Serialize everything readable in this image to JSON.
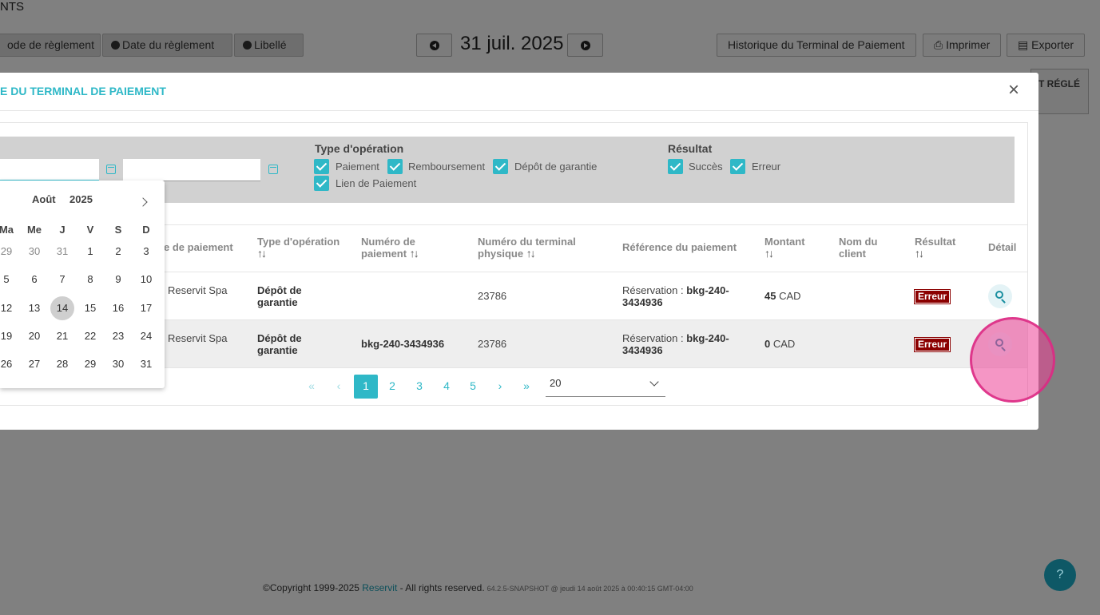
{
  "background": {
    "title": "NTS",
    "filter_buttons": [
      "ode de règlement",
      "Date du règlement",
      "Libellé"
    ],
    "date": "31 juil. 2025",
    "right_buttons": [
      "Historique du Terminal de Paiement",
      "Imprimer",
      "Exporter"
    ],
    "right_panel_text": "IT RÉGLÉ"
  },
  "modal": {
    "title": "E DU TERMINAL DE PAIEMENT",
    "close": "×"
  },
  "filters": {
    "operation_type": {
      "label": "Type d'opération",
      "options": [
        "Paiement",
        "Remboursement",
        "Dépôt de garantie",
        "Lien de Paiement"
      ]
    },
    "result": {
      "label": "Résultat",
      "options": [
        "Succès",
        "Erreur"
      ]
    }
  },
  "table": {
    "headers": [
      "e de paiement",
      "Type d'opération",
      "Numéro de paiement",
      "Numéro du terminal physique",
      "Référence du paiement",
      "Montant",
      "Nom du client",
      "Résultat",
      "Détail"
    ],
    "header_parts": {
      "type_op": "Type d'opération",
      "num_pay_1": "Numéro de",
      "num_pay_2": "paiement",
      "num_term_1": "Numéro du terminal",
      "num_term_2": "physique",
      "nom_1": "Nom du",
      "nom_2": "client"
    },
    "rows": [
      {
        "merchant": "Reservit Spa",
        "type_1": "Dépôt de",
        "type_2": "garantie",
        "payment_number": "",
        "terminal": "23786",
        "ref_prefix": "Réservation : ",
        "ref_1": "bkg-240-",
        "ref_2": "3434936",
        "amount": "45",
        "currency": "CAD",
        "client": "",
        "result": "Erreur"
      },
      {
        "merchant": "Reservit Spa",
        "type_1": "Dépôt de",
        "type_2": "garantie",
        "payment_number": "bkg-240-3434936",
        "terminal": "23786",
        "ref_prefix": "Réservation : ",
        "ref_1": "bkg-240-",
        "ref_2": "3434936",
        "amount": "0",
        "currency": "CAD",
        "client": "",
        "result": "Erreur"
      }
    ]
  },
  "pagination": {
    "first": "«",
    "prev": "‹",
    "pages": [
      "1",
      "2",
      "3",
      "4",
      "5"
    ],
    "next": "›",
    "last": "»",
    "per_page": "20"
  },
  "datepicker": {
    "month": "Août",
    "year": "2025",
    "weekdays": [
      "Ma",
      "Me",
      "J",
      "V",
      "S",
      "D"
    ],
    "weeks": [
      [
        "29",
        "30",
        "31",
        "1",
        "2",
        "3"
      ],
      [
        "5",
        "6",
        "7",
        "8",
        "9",
        "10"
      ],
      [
        "12",
        "13",
        "14",
        "15",
        "16",
        "17"
      ],
      [
        "19",
        "20",
        "21",
        "22",
        "23",
        "24"
      ],
      [
        "26",
        "27",
        "28",
        "29",
        "30",
        "31"
      ]
    ],
    "today": "14"
  },
  "footer": {
    "copyright": "©Copyright 1999-2025 ",
    "brand": "Reservit",
    "rights": " - All rights reserved.",
    "version": "64.2.5-SNAPSHOT @ jeudi 14 août 2025 à 00:40:15 GMT-04:00"
  },
  "help": "?",
  "colors": {
    "accent": "#2fb8c7",
    "error": "#8b0000"
  }
}
